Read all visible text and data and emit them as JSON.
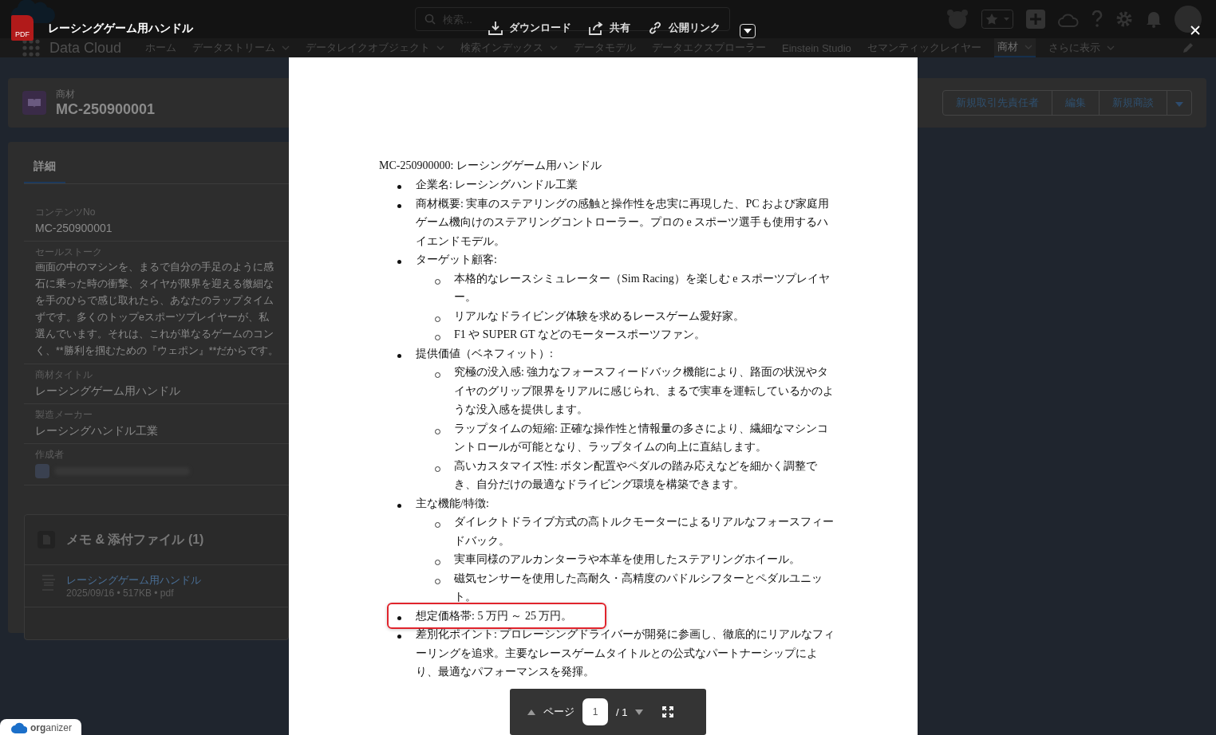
{
  "app": {
    "search": {
      "placeholder": "検索..."
    },
    "app_name": "Data Cloud",
    "nav_items": [
      {
        "label": "ホーム",
        "has_menu": false,
        "selected": false
      },
      {
        "label": "データストリーム",
        "has_menu": true,
        "selected": false
      },
      {
        "label": "データレイクオブジェクト",
        "has_menu": true,
        "selected": false
      },
      {
        "label": "検索インデックス",
        "has_menu": true,
        "selected": false
      },
      {
        "label": "データモデル",
        "has_menu": false,
        "selected": false
      },
      {
        "label": "データエクスプローラー",
        "has_menu": false,
        "selected": false
      },
      {
        "label": "Einstein Studio",
        "has_menu": false,
        "selected": false
      },
      {
        "label": "セマンティックレイヤー",
        "has_menu": false,
        "selected": false
      },
      {
        "label": "商材",
        "has_menu": true,
        "selected": true
      },
      {
        "label": "さらに表示",
        "has_menu": true,
        "selected": false
      }
    ]
  },
  "record": {
    "object_label": "商材",
    "name": "MC-250900001",
    "buttons": [
      "新規取引先責任者",
      "編集",
      "新規商談"
    ]
  },
  "details": {
    "tabs": [
      {
        "label": "詳細",
        "selected": true
      }
    ],
    "fields": [
      {
        "kind": "text",
        "label": "コンテンツNo",
        "value": "MC-250900001"
      },
      {
        "kind": "lines",
        "label": "セールストーク",
        "lines": [
          "画面の中のマシンを、まるで自分の手足のように感",
          "石に乗った時の衝撃、タイヤが限界を迎える微細な",
          "を手のひらで感じ取れたら、あなたのラップタイム",
          "ずです。多くのトップeスポーツプレイヤーが、私",
          "選んでいます。それは、これが単なるゲームのコン",
          "く、**勝利を掴むための『ウェポン』**だからです。"
        ]
      },
      {
        "kind": "text",
        "label": "商材タイトル",
        "value": "レーシングゲーム用ハンドル"
      },
      {
        "kind": "text",
        "label": "製造メーカー",
        "value": "レーシングハンドル工業"
      },
      {
        "kind": "user",
        "label": "作成者"
      }
    ]
  },
  "notes": {
    "title": "メモ & 添付ファイル (1)",
    "files": [
      {
        "name": "レーシングゲーム用ハンドル",
        "meta": "2025/09/16 • 517KB • pdf"
      }
    ]
  },
  "organizer": "**org**anizer",
  "viewer": {
    "file_type": "PDF",
    "title": "レーシングゲーム用ハンドル",
    "actions": [
      {
        "kind": "download",
        "label": "ダウンロード"
      },
      {
        "kind": "share",
        "label": "共有"
      },
      {
        "kind": "link",
        "label": "公開リンク"
      }
    ]
  },
  "document": {
    "title": "MC-250900000: レーシングゲーム用ハンドル",
    "items": [
      {
        "text": "企業名: レーシングハンドル工業",
        "highlighted": false
      },
      {
        "text": "商材概要: 実車のステアリングの感触と操作性を忠実に再現した、PC および家庭用ゲーム機向けのステアリングコントローラー。プロの e スポーツ選手も使用するハイエンドモデル。",
        "highlighted": false
      },
      {
        "text": "ターゲット顧客:",
        "highlighted": false,
        "children": [
          {
            "text": "本格的なレースシミュレーター（Sim Racing）を楽しむ e スポーツプレイヤー。"
          },
          {
            "text": "リアルなドライビング体験を求めるレースゲーム愛好家。"
          },
          {
            "text": "F1 や SUPER GT などのモータースポーツファン。"
          }
        ]
      },
      {
        "text": "提供価値（ベネフィット）:",
        "highlighted": false,
        "children": [
          {
            "text": "究極の没入感: 強力なフォースフィードバック機能により、路面の状況やタイヤのグリップ限界をリアルに感じられ、まるで実車を運転しているかのような没入感を提供します。"
          },
          {
            "text": "ラップタイムの短縮: 正確な操作性と情報量の多さにより、繊細なマシンコントロールが可能となり、ラップタイムの向上に直結します。"
          },
          {
            "text": "高いカスタマイズ性: ボタン配置やペダルの踏み応えなどを細かく調整でき、自分だけの最適なドライビング環境を構築できます。"
          }
        ]
      },
      {
        "text": "主な機能/特徴:",
        "highlighted": false,
        "children": [
          {
            "text": "ダイレクトドライブ方式の高トルクモーターによるリアルなフォースフィードバック。"
          },
          {
            "text": "実車同様のアルカンターラや本革を使用したステアリングホイール。"
          },
          {
            "text": "磁気センサーを使用した高耐久・高精度のパドルシフターとペダルユニット。"
          }
        ]
      },
      {
        "text": "想定価格帯: 5 万円 ～ 25 万円。",
        "highlighted": true
      },
      {
        "text": "差別化ポイント: プロレーシングドライバーが開発に参画し、徹底的にリアルなフィーリングを追求。主要なレースゲームタイトルとの公式なパートナーシップにより、最適なパフォーマンスを発揮。",
        "highlighted": false
      }
    ]
  },
  "pager": {
    "label": "ページ",
    "page": "1",
    "total": "/ 1"
  }
}
